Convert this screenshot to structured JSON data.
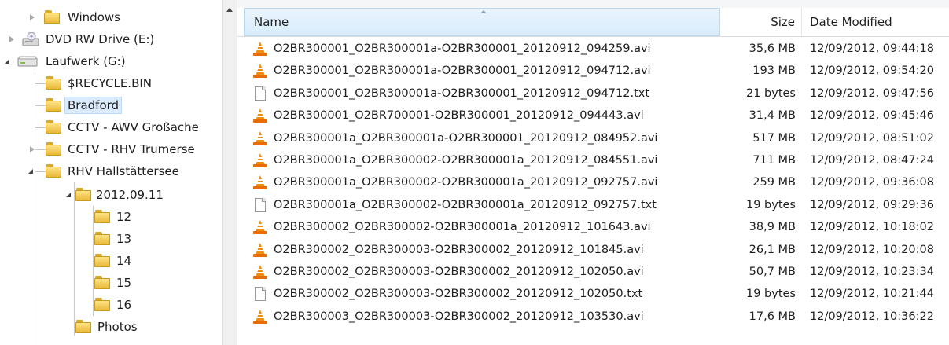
{
  "tree": {
    "items": [
      {
        "label": "Windows",
        "icon": "folder-icon"
      },
      {
        "label": "DVD RW Drive (E:)",
        "icon": "dvd-drive-icon"
      },
      {
        "label": "Laufwerk (G:)",
        "icon": "hard-drive-icon"
      },
      {
        "label": "$RECYCLE.BIN",
        "icon": "folder-icon"
      },
      {
        "label": "Bradford",
        "icon": "folder-icon",
        "selected": true
      },
      {
        "label": "CCTV - AWV Großache",
        "icon": "folder-icon"
      },
      {
        "label": "CCTV - RHV Trumerse",
        "icon": "folder-icon"
      },
      {
        "label": "RHV Hallstättersee",
        "icon": "folder-icon"
      },
      {
        "label": "2012.09.11",
        "icon": "folder-icon"
      },
      {
        "label": "12",
        "icon": "folder-icon"
      },
      {
        "label": "13",
        "icon": "folder-icon"
      },
      {
        "label": "14",
        "icon": "folder-icon"
      },
      {
        "label": "15",
        "icon": "folder-icon"
      },
      {
        "label": "16",
        "icon": "folder-icon"
      },
      {
        "label": "Photos",
        "icon": "folder-icon"
      }
    ]
  },
  "list": {
    "columns": {
      "name": "Name",
      "size": "Size",
      "date": "Date Modified"
    },
    "files": [
      {
        "name": "O2BR300001_O2BR300001a-O2BR300001_20120912_094259.avi",
        "size": "35,6 MB",
        "date": "12/09/2012, 09:44:18",
        "type": "vlc-icon"
      },
      {
        "name": "O2BR300001_O2BR300001a-O2BR300001_20120912_094712.avi",
        "size": "193 MB",
        "date": "12/09/2012, 09:54:20",
        "type": "vlc-icon"
      },
      {
        "name": "O2BR300001_O2BR300001a-O2BR300001_20120912_094712.txt",
        "size": "21 bytes",
        "date": "12/09/2012, 09:47:56",
        "type": "text-file-icon"
      },
      {
        "name": "O2BR300001_O2BR700001-O2BR300001_20120912_094443.avi",
        "size": "31,4 MB",
        "date": "12/09/2012, 09:45:46",
        "type": "vlc-icon"
      },
      {
        "name": "O2BR300001a_O2BR300001a-O2BR300001_20120912_084952.avi",
        "size": "517 MB",
        "date": "12/09/2012, 08:51:02",
        "type": "vlc-icon"
      },
      {
        "name": "O2BR300001a_O2BR300002-O2BR300001a_20120912_084551.avi",
        "size": "711 MB",
        "date": "12/09/2012, 08:47:24",
        "type": "vlc-icon"
      },
      {
        "name": "O2BR300001a_O2BR300002-O2BR300001a_20120912_092757.avi",
        "size": "259 MB",
        "date": "12/09/2012, 09:36:08",
        "type": "vlc-icon"
      },
      {
        "name": "O2BR300001a_O2BR300002-O2BR300001a_20120912_092757.txt",
        "size": "19 bytes",
        "date": "12/09/2012, 09:29:36",
        "type": "text-file-icon"
      },
      {
        "name": "O2BR300002_O2BR300002-O2BR300001a_20120912_101643.avi",
        "size": "38,9 MB",
        "date": "12/09/2012, 10:18:02",
        "type": "vlc-icon"
      },
      {
        "name": "O2BR300002_O2BR300003-O2BR300002_20120912_101845.avi",
        "size": "26,1 MB",
        "date": "12/09/2012, 10:20:08",
        "type": "vlc-icon"
      },
      {
        "name": "O2BR300002_O2BR300003-O2BR300002_20120912_102050.avi",
        "size": "50,7 MB",
        "date": "12/09/2012, 10:23:34",
        "type": "vlc-icon"
      },
      {
        "name": "O2BR300002_O2BR300003-O2BR300002_20120912_102050.txt",
        "size": "19 bytes",
        "date": "12/09/2012, 10:21:44",
        "type": "text-file-icon"
      },
      {
        "name": "O2BR300003_O2BR300003-O2BR300002_20120912_103530.avi",
        "size": "17,6 MB",
        "date": "12/09/2012, 10:36:22",
        "type": "vlc-icon"
      }
    ]
  }
}
